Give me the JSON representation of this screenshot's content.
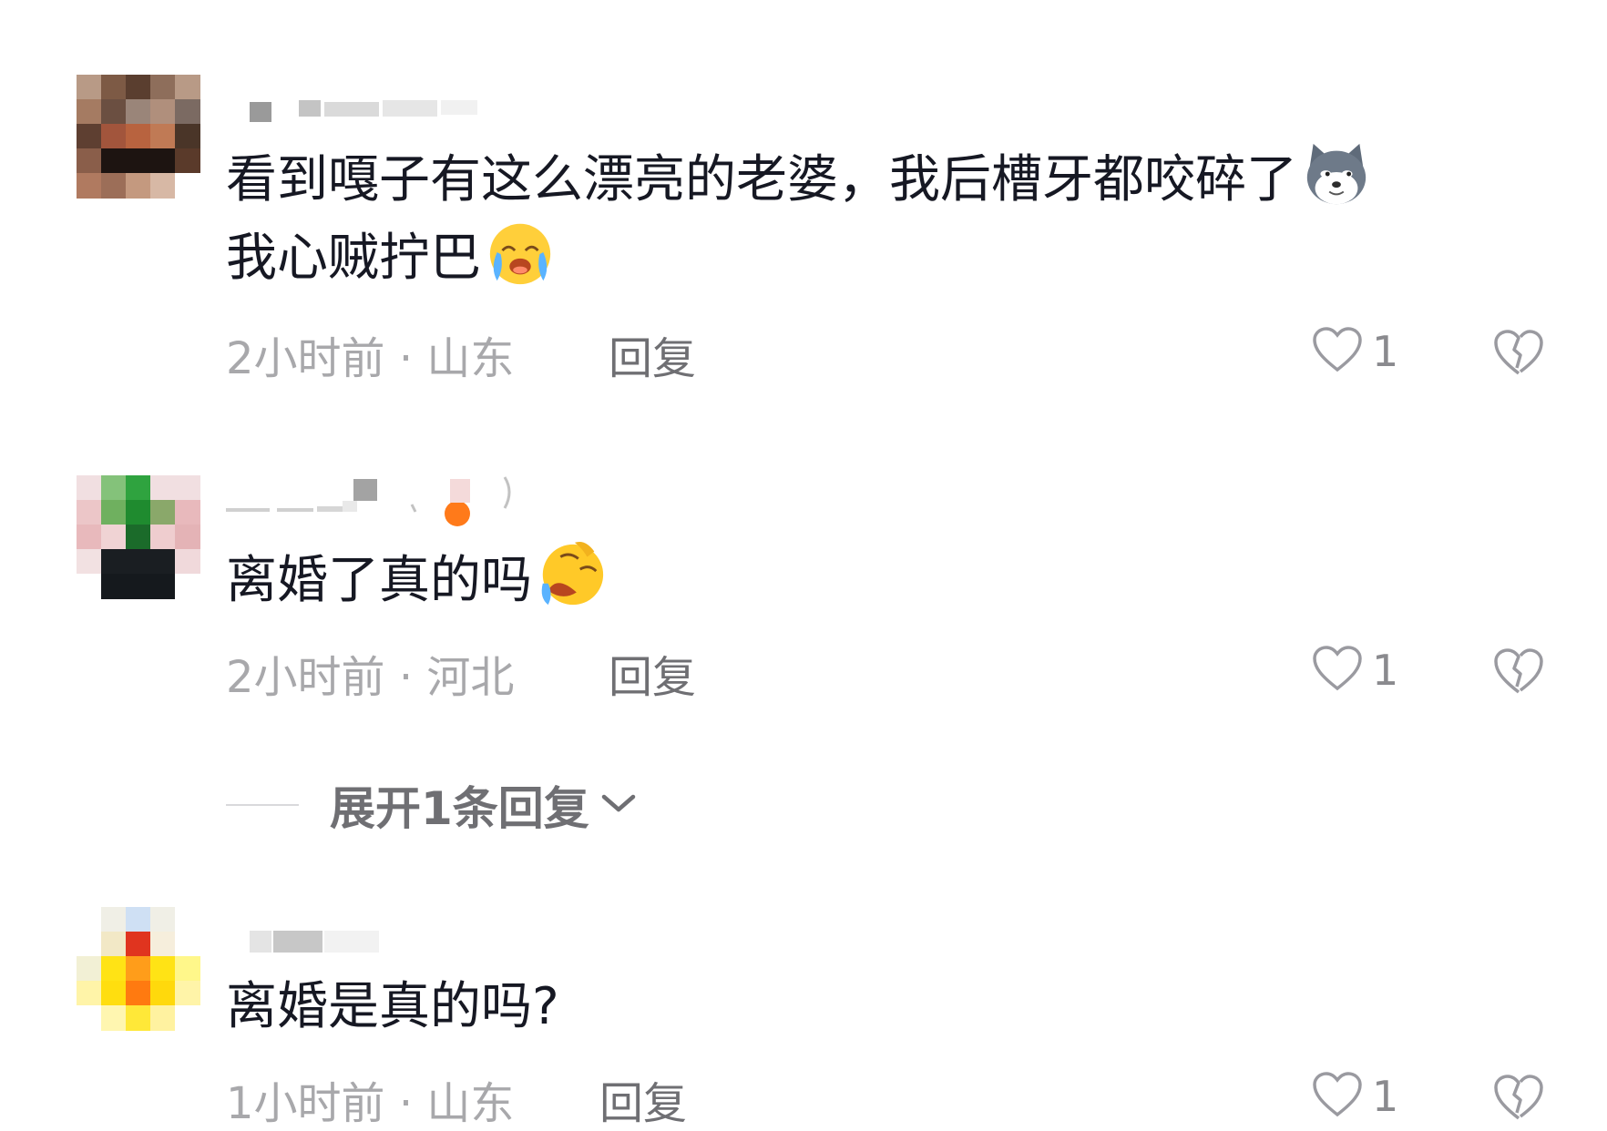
{
  "comments": [
    {
      "text": "看到嘎子有这么漂亮的老婆，我后槽牙都咬碎了",
      "text2": "我心贼拧巴",
      "time": "2小时前",
      "region": "山东",
      "reply_label": "回复",
      "likes": "1",
      "emojis": [
        "doge-dog-emoji",
        "crying-laugh-emoji"
      ]
    },
    {
      "text": "离婚了真的吗",
      "time": "2小时前",
      "region": "河北",
      "reply_label": "回复",
      "likes": "1",
      "emojis": [
        "rolling-laugh-emoji"
      ]
    },
    {
      "text": "离婚是真的吗?",
      "time": "1小时前",
      "region": "山东",
      "reply_label": "回复",
      "likes": "1"
    }
  ],
  "expand_replies": {
    "label": "展开1条回复"
  },
  "icons": {
    "like": "heart-outline-icon",
    "dislike": "broken-heart-icon",
    "expand": "chevron-down-icon"
  },
  "colors": {
    "text": "#161823",
    "meta": "#a8a8ab",
    "reply": "#6f6f73"
  }
}
